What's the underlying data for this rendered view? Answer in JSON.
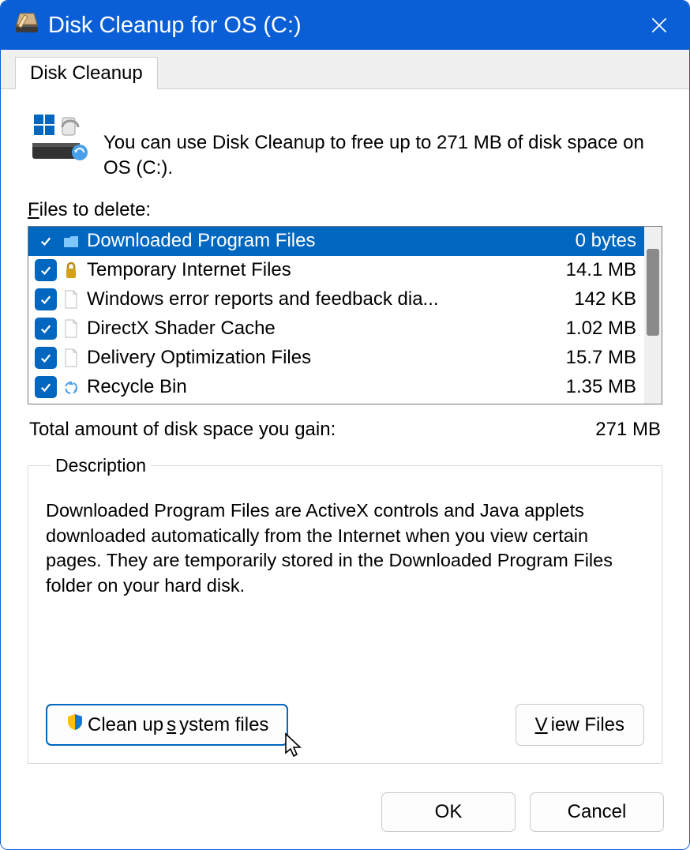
{
  "titlebar": {
    "title": "Disk Cleanup for OS (C:)"
  },
  "tab": {
    "label": "Disk Cleanup"
  },
  "intro": {
    "text": "You can use Disk Cleanup to free up to 271 MB of disk space on OS (C:)."
  },
  "files_label_pre": "F",
  "files_label_post": "iles to delete:",
  "rows": [
    {
      "name": "Downloaded Program Files",
      "size": "0 bytes",
      "checked": true,
      "selected": true,
      "icon": "folder-blue-icon"
    },
    {
      "name": "Temporary Internet Files",
      "size": "14.1 MB",
      "checked": true,
      "selected": false,
      "icon": "lock-icon"
    },
    {
      "name": "Windows error reports and feedback dia...",
      "size": "142 KB",
      "checked": true,
      "selected": false,
      "icon": "file-icon"
    },
    {
      "name": "DirectX Shader Cache",
      "size": "1.02 MB",
      "checked": true,
      "selected": false,
      "icon": "file-icon"
    },
    {
      "name": "Delivery Optimization Files",
      "size": "15.7 MB",
      "checked": true,
      "selected": false,
      "icon": "file-icon"
    },
    {
      "name": "Recycle Bin",
      "size": "1.35 MB",
      "checked": true,
      "selected": false,
      "icon": "recycle-icon"
    }
  ],
  "total": {
    "label": "Total amount of disk space you gain:",
    "value": "271 MB"
  },
  "description": {
    "legend": "Description",
    "text": "Downloaded Program Files are ActiveX controls and Java applets downloaded automatically from the Internet when you view certain pages. They are temporarily stored in the Downloaded Program Files folder on your hard disk."
  },
  "buttons": {
    "cleanup_pre": "Clean up ",
    "cleanup_u": "s",
    "cleanup_post": "ystem files",
    "view_pre": "",
    "view_u": "V",
    "view_post": "iew Files",
    "ok": "OK",
    "cancel": "Cancel"
  }
}
